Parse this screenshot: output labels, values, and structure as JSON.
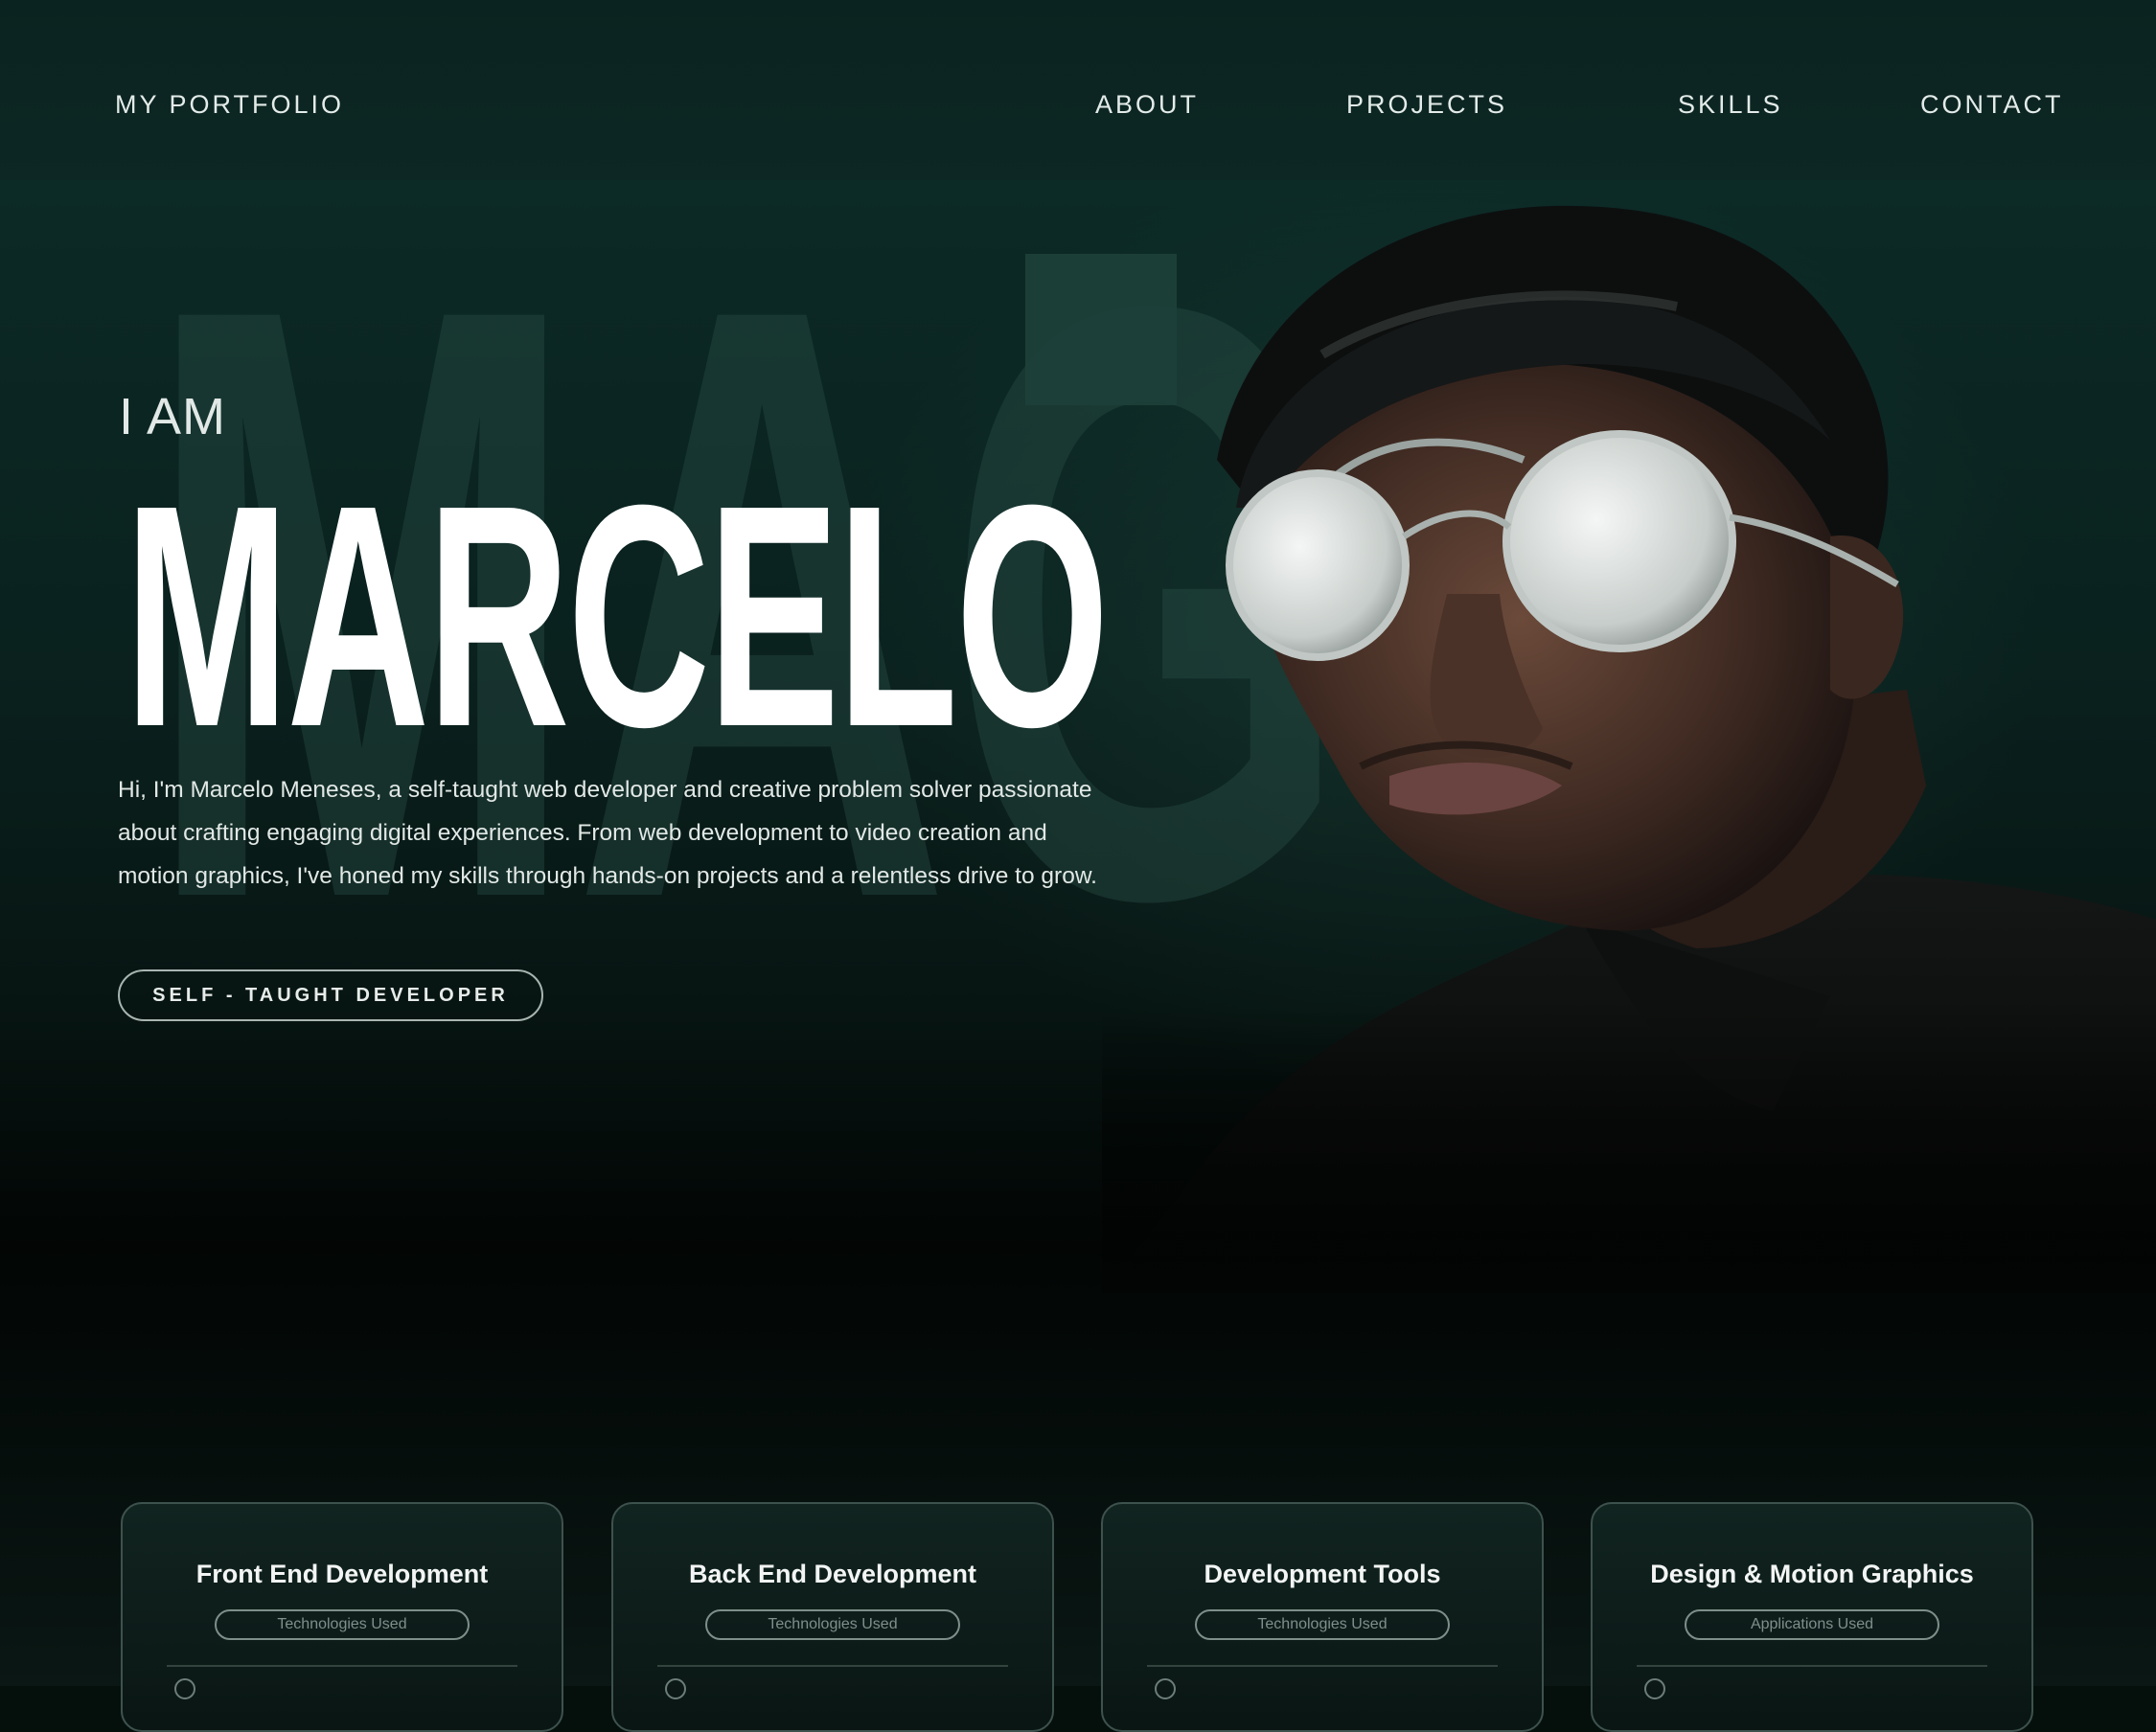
{
  "nav": {
    "logo": "MY PORTFOLIO",
    "links": [
      "ABOUT",
      "PROJECTS",
      "SKILLS",
      "CONTACT"
    ]
  },
  "hero": {
    "background_word": "MAG",
    "intro": "I AM",
    "name": "MARCELO",
    "bio": "Hi, I'm Marcelo Meneses, a self-taught web developer and creative problem solver passionate about crafting engaging digital experiences. From web development to video creation and motion graphics, I've honed my skills through hands-on projects and a relentless drive to grow.",
    "badge": "SELF - TAUGHT DEVELOPER"
  },
  "cards": [
    {
      "title": "Front End Development",
      "pill": "Technologies Used"
    },
    {
      "title": "Back End Development",
      "pill": "Technologies Used"
    },
    {
      "title": "Development Tools",
      "pill": "Technologies Used"
    },
    {
      "title": "Design & Motion Graphics",
      "pill": "Applications Used"
    }
  ],
  "colors": {
    "background": "#0b2622",
    "accent_block": "#1d413a",
    "text": "#e3ebe8"
  }
}
